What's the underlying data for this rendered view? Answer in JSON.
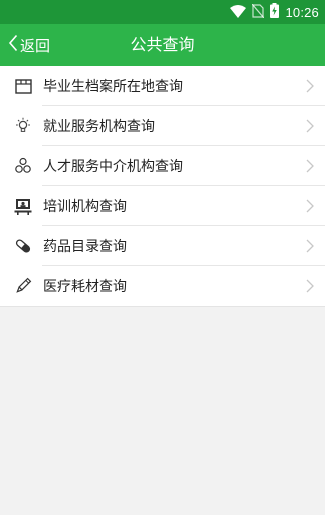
{
  "status_bar": {
    "time": "10:26",
    "icons": [
      "wifi-icon",
      "no-sim-icon",
      "battery-charging-icon"
    ]
  },
  "app_bar": {
    "back_label": "返回",
    "title": "公共查询"
  },
  "menu": [
    {
      "label": "毕业生档案所在地查询",
      "icon": "archive-icon"
    },
    {
      "label": "就业服务机构查询",
      "icon": "lightbulb-icon"
    },
    {
      "label": "人才服务中介机构查询",
      "icon": "people-icon"
    },
    {
      "label": "培训机构查询",
      "icon": "classroom-icon"
    },
    {
      "label": "药品目录查询",
      "icon": "pill-icon"
    },
    {
      "label": "医疗耗材查询",
      "icon": "pencil-icon"
    }
  ],
  "colors": {
    "status_bar": "#1e9638",
    "app_bar": "#2db44a",
    "background": "#f2f2f2"
  }
}
